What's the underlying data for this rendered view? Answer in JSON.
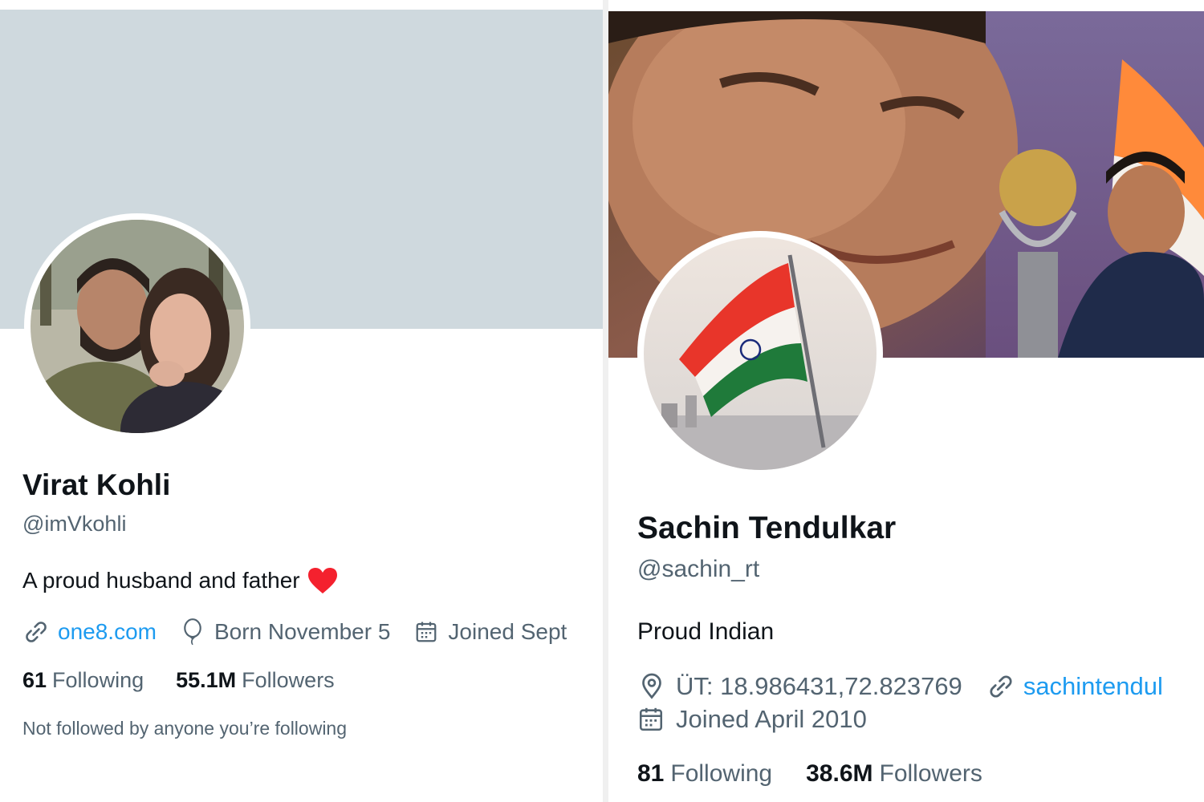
{
  "profiles": [
    {
      "name": "Virat Kohli",
      "handle": "@imVkohli",
      "bio": "A proud husband and father",
      "website": "one8.com",
      "birth": "Born November 5",
      "joined": "Joined Sept",
      "following_count": "61",
      "following_label": "Following",
      "followers_count": "55.1M",
      "followers_label": "Followers",
      "mutuals_note": "Not followed by anyone you’re following"
    },
    {
      "name": "Sachin Tendulkar",
      "handle": "@sachin_rt",
      "bio": "Proud Indian",
      "location": "ÜT: 18.986431,72.823769",
      "website": "sachintendul",
      "joined": "Joined April 2010",
      "following_count": "81",
      "following_label": "Following",
      "followers_count": "38.6M",
      "followers_label": "Followers"
    }
  ],
  "colors": {
    "link": "#1d9bf0",
    "secondary_text": "#536471",
    "primary_text": "#0f1419",
    "banner_plain": "#cfd9de",
    "heart": "#f4212e"
  },
  "icons": [
    "link-icon",
    "birthday-balloon-icon",
    "calendar-icon",
    "location-pin-icon",
    "heart-emoji-icon"
  ]
}
